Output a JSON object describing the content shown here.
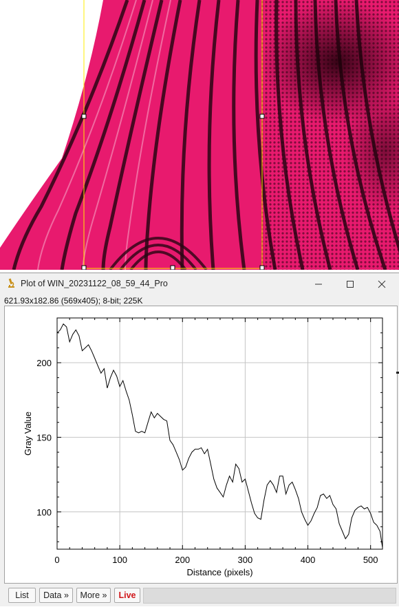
{
  "plot_window": {
    "title": "Plot of WIN_20231122_08_59_44_Pro",
    "info": "621.93x182.86  (569x405); 8-bit; 225K",
    "buttons": {
      "list": "List",
      "data": "Data »",
      "more": "More »",
      "live": "Live"
    },
    "live_color": "#d0161a"
  },
  "chart_data": {
    "type": "line",
    "xlabel": "Distance (pixels)",
    "ylabel": "Gray Value",
    "xlim": [
      0,
      519
    ],
    "ylim": [
      75,
      230
    ],
    "x_ticks": [
      0,
      100,
      200,
      300,
      400,
      500
    ],
    "y_ticks": [
      100,
      150,
      200
    ],
    "grid": true,
    "line_color": "#000000",
    "series": [
      {
        "x": [
          0,
          5,
          10,
          15,
          20,
          25,
          30,
          35,
          40,
          45,
          50,
          55,
          60,
          65,
          70,
          75,
          80,
          85,
          90,
          95,
          100,
          105,
          110,
          115,
          120,
          125,
          130,
          135,
          140,
          145,
          150,
          155,
          160,
          165,
          170,
          175,
          180,
          185,
          190,
          195,
          200,
          205,
          210,
          215,
          220,
          225,
          230,
          235,
          240,
          245,
          250,
          255,
          260,
          265,
          270,
          275,
          280,
          285,
          290,
          295,
          300,
          305,
          310,
          315,
          320,
          325,
          330,
          335,
          340,
          345,
          350,
          355,
          360,
          365,
          370,
          375,
          380,
          385,
          390,
          395,
          400,
          405,
          410,
          415,
          420,
          425,
          430,
          435,
          440,
          445,
          450,
          455,
          460,
          465,
          470,
          475,
          480,
          485,
          490,
          495,
          500,
          505,
          510,
          515,
          519
        ],
        "y": [
          220,
          222,
          226,
          224,
          214,
          219,
          222,
          218,
          208,
          210,
          212,
          208,
          203,
          198,
          193,
          196,
          183,
          190,
          195,
          191,
          184,
          188,
          181,
          175,
          165,
          154,
          153,
          154,
          153,
          160,
          167,
          163,
          166,
          164,
          162,
          161,
          148,
          145,
          140,
          135,
          128,
          130,
          136,
          140,
          142,
          142,
          143,
          139,
          142,
          132,
          122,
          116,
          113,
          110,
          118,
          124,
          120,
          132,
          129,
          120,
          122,
          114,
          106,
          99,
          96,
          95,
          108,
          118,
          121,
          118,
          113,
          124,
          124,
          112,
          118,
          120,
          115,
          109,
          100,
          95,
          91,
          94,
          99,
          103,
          111,
          112,
          109,
          111,
          105,
          102,
          92,
          87,
          82,
          85,
          96,
          101,
          103,
          104,
          102,
          103,
          99,
          93,
          91,
          87,
          76
        ]
      }
    ]
  }
}
